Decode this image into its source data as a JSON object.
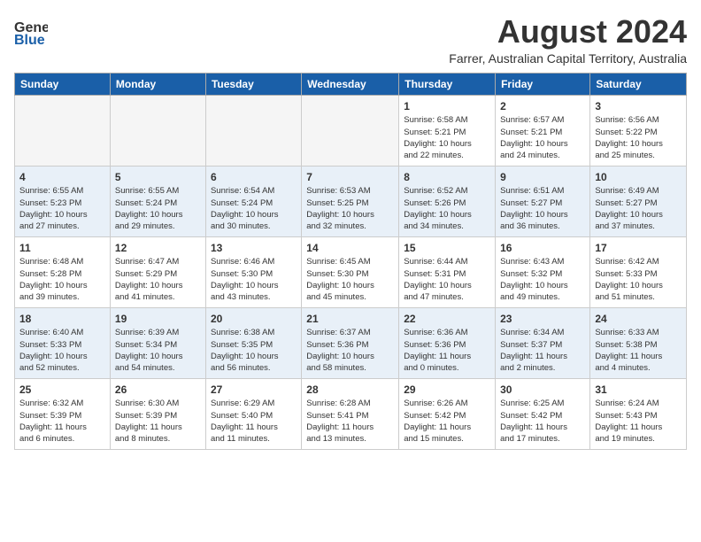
{
  "header": {
    "logo": {
      "line1": "General",
      "line2": "Blue"
    },
    "month_year": "August 2024",
    "location": "Farrer, Australian Capital Territory, Australia"
  },
  "calendar": {
    "weekdays": [
      "Sunday",
      "Monday",
      "Tuesday",
      "Wednesday",
      "Thursday",
      "Friday",
      "Saturday"
    ],
    "weeks": [
      [
        {
          "day": "",
          "info": ""
        },
        {
          "day": "",
          "info": ""
        },
        {
          "day": "",
          "info": ""
        },
        {
          "day": "",
          "info": ""
        },
        {
          "day": "1",
          "info": "Sunrise: 6:58 AM\nSunset: 5:21 PM\nDaylight: 10 hours\nand 22 minutes."
        },
        {
          "day": "2",
          "info": "Sunrise: 6:57 AM\nSunset: 5:21 PM\nDaylight: 10 hours\nand 24 minutes."
        },
        {
          "day": "3",
          "info": "Sunrise: 6:56 AM\nSunset: 5:22 PM\nDaylight: 10 hours\nand 25 minutes."
        }
      ],
      [
        {
          "day": "4",
          "info": "Sunrise: 6:55 AM\nSunset: 5:23 PM\nDaylight: 10 hours\nand 27 minutes."
        },
        {
          "day": "5",
          "info": "Sunrise: 6:55 AM\nSunset: 5:24 PM\nDaylight: 10 hours\nand 29 minutes."
        },
        {
          "day": "6",
          "info": "Sunrise: 6:54 AM\nSunset: 5:24 PM\nDaylight: 10 hours\nand 30 minutes."
        },
        {
          "day": "7",
          "info": "Sunrise: 6:53 AM\nSunset: 5:25 PM\nDaylight: 10 hours\nand 32 minutes."
        },
        {
          "day": "8",
          "info": "Sunrise: 6:52 AM\nSunset: 5:26 PM\nDaylight: 10 hours\nand 34 minutes."
        },
        {
          "day": "9",
          "info": "Sunrise: 6:51 AM\nSunset: 5:27 PM\nDaylight: 10 hours\nand 36 minutes."
        },
        {
          "day": "10",
          "info": "Sunrise: 6:49 AM\nSunset: 5:27 PM\nDaylight: 10 hours\nand 37 minutes."
        }
      ],
      [
        {
          "day": "11",
          "info": "Sunrise: 6:48 AM\nSunset: 5:28 PM\nDaylight: 10 hours\nand 39 minutes."
        },
        {
          "day": "12",
          "info": "Sunrise: 6:47 AM\nSunset: 5:29 PM\nDaylight: 10 hours\nand 41 minutes."
        },
        {
          "day": "13",
          "info": "Sunrise: 6:46 AM\nSunset: 5:30 PM\nDaylight: 10 hours\nand 43 minutes."
        },
        {
          "day": "14",
          "info": "Sunrise: 6:45 AM\nSunset: 5:30 PM\nDaylight: 10 hours\nand 45 minutes."
        },
        {
          "day": "15",
          "info": "Sunrise: 6:44 AM\nSunset: 5:31 PM\nDaylight: 10 hours\nand 47 minutes."
        },
        {
          "day": "16",
          "info": "Sunrise: 6:43 AM\nSunset: 5:32 PM\nDaylight: 10 hours\nand 49 minutes."
        },
        {
          "day": "17",
          "info": "Sunrise: 6:42 AM\nSunset: 5:33 PM\nDaylight: 10 hours\nand 51 minutes."
        }
      ],
      [
        {
          "day": "18",
          "info": "Sunrise: 6:40 AM\nSunset: 5:33 PM\nDaylight: 10 hours\nand 52 minutes."
        },
        {
          "day": "19",
          "info": "Sunrise: 6:39 AM\nSunset: 5:34 PM\nDaylight: 10 hours\nand 54 minutes."
        },
        {
          "day": "20",
          "info": "Sunrise: 6:38 AM\nSunset: 5:35 PM\nDaylight: 10 hours\nand 56 minutes."
        },
        {
          "day": "21",
          "info": "Sunrise: 6:37 AM\nSunset: 5:36 PM\nDaylight: 10 hours\nand 58 minutes."
        },
        {
          "day": "22",
          "info": "Sunrise: 6:36 AM\nSunset: 5:36 PM\nDaylight: 11 hours\nand 0 minutes."
        },
        {
          "day": "23",
          "info": "Sunrise: 6:34 AM\nSunset: 5:37 PM\nDaylight: 11 hours\nand 2 minutes."
        },
        {
          "day": "24",
          "info": "Sunrise: 6:33 AM\nSunset: 5:38 PM\nDaylight: 11 hours\nand 4 minutes."
        }
      ],
      [
        {
          "day": "25",
          "info": "Sunrise: 6:32 AM\nSunset: 5:39 PM\nDaylight: 11 hours\nand 6 minutes."
        },
        {
          "day": "26",
          "info": "Sunrise: 6:30 AM\nSunset: 5:39 PM\nDaylight: 11 hours\nand 8 minutes."
        },
        {
          "day": "27",
          "info": "Sunrise: 6:29 AM\nSunset: 5:40 PM\nDaylight: 11 hours\nand 11 minutes."
        },
        {
          "day": "28",
          "info": "Sunrise: 6:28 AM\nSunset: 5:41 PM\nDaylight: 11 hours\nand 13 minutes."
        },
        {
          "day": "29",
          "info": "Sunrise: 6:26 AM\nSunset: 5:42 PM\nDaylight: 11 hours\nand 15 minutes."
        },
        {
          "day": "30",
          "info": "Sunrise: 6:25 AM\nSunset: 5:42 PM\nDaylight: 11 hours\nand 17 minutes."
        },
        {
          "day": "31",
          "info": "Sunrise: 6:24 AM\nSunset: 5:43 PM\nDaylight: 11 hours\nand 19 minutes."
        }
      ]
    ]
  }
}
